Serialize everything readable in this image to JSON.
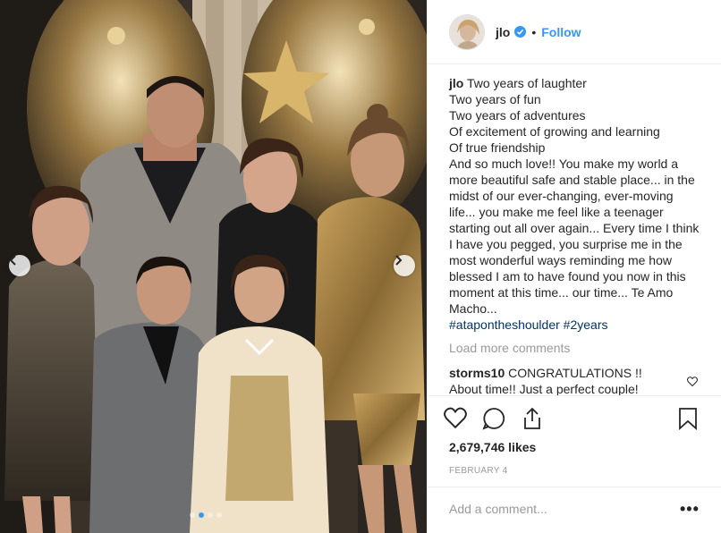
{
  "colors": {
    "link": "#3897f0",
    "hashtag": "#003569",
    "muted": "#999999",
    "border": "#efefef"
  },
  "header": {
    "username": "jlo",
    "bullet": "•",
    "follow_label": "Follow",
    "avatar_icon": "avatar-portrait",
    "verified_icon": "verified-badge-icon"
  },
  "caption": {
    "username": "jlo",
    "lines": [
      "Two years of laughter",
      "Two years of fun",
      "Two years of adventures",
      "Of excitement of growing and learning",
      "Of true friendship",
      "And so much love!! You make my world a more beautiful safe and stable place... in the midst of our ever-changing, ever-moving life... you make me feel like a teenager starting out all over again... Every time I think I have you pegged, you surprise me in the most wonderful ways reminding me how blessed I am to have found you now in this moment at this time... our time... Te Amo Macho..."
    ],
    "hashtags": [
      "#ataponthe shoulder",
      "#2years"
    ]
  },
  "comments": {
    "load_more": "Load more comments",
    "items": [
      {
        "username": "storms10",
        "text": "CONGRATULATIONS !! About time!! Just a perfect couple!"
      }
    ]
  },
  "actions": {
    "icons": [
      "heart-icon",
      "comment-icon",
      "share-icon",
      "bookmark-icon"
    ]
  },
  "likes": "2,679,746 likes",
  "date": "FEBRUARY 4",
  "add_comment": {
    "placeholder": "Add a comment...",
    "more": "•••"
  },
  "carousel": {
    "slides": 4,
    "active_index": 1
  }
}
